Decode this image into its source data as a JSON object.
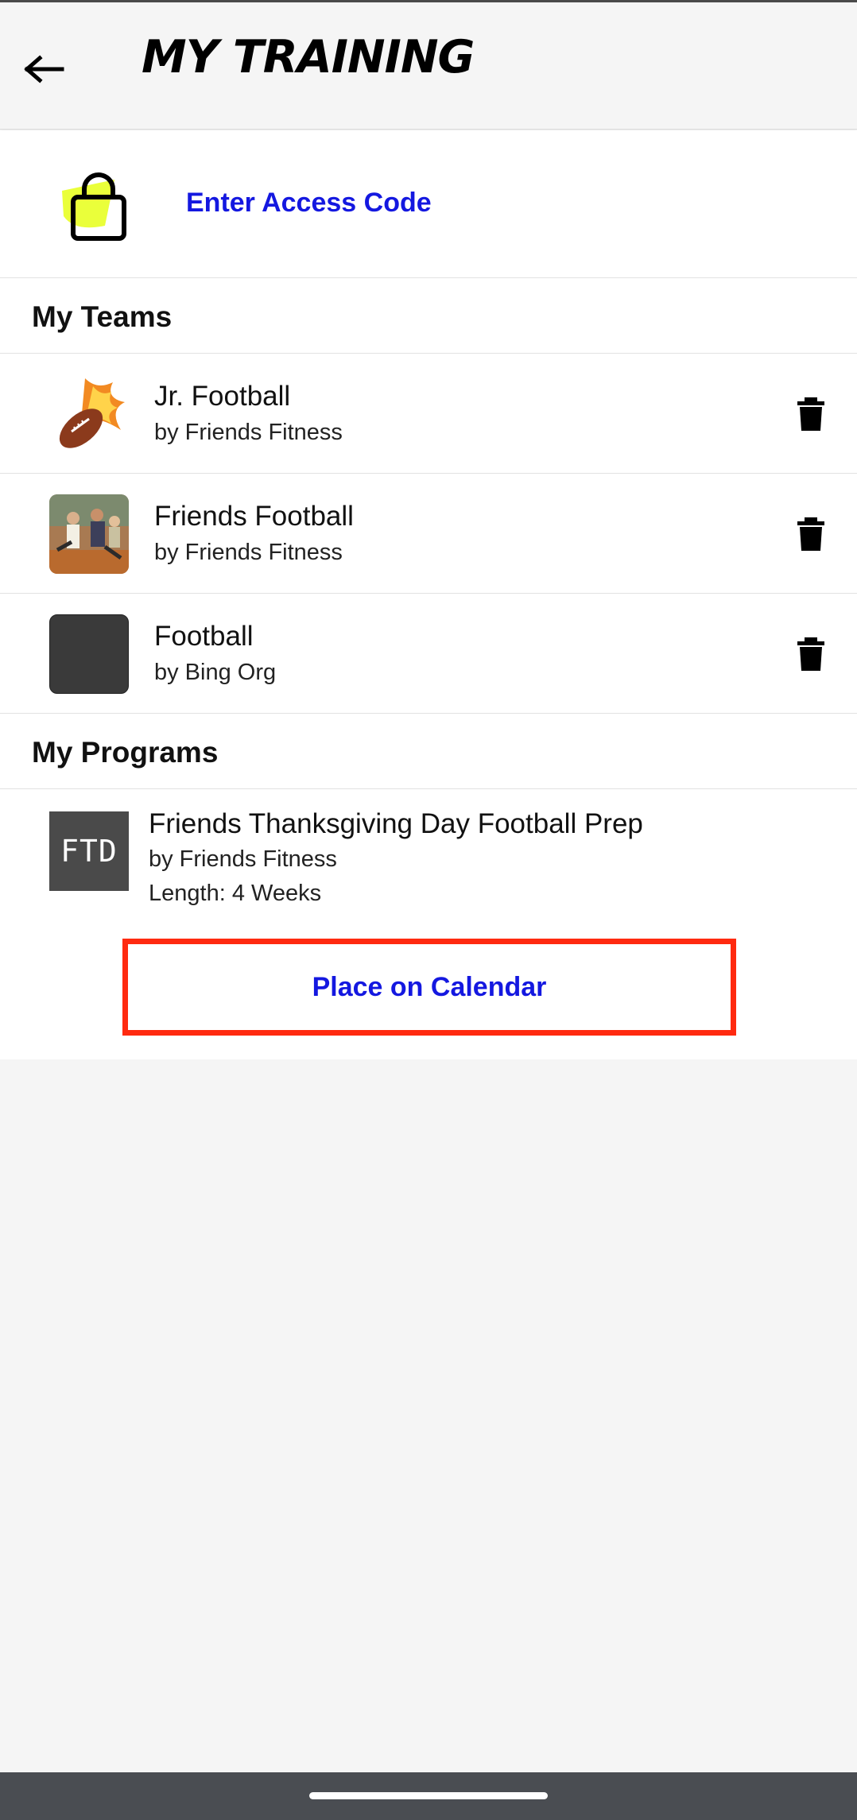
{
  "header": {
    "title": "MY TRAINING",
    "back_icon": "arrow-left-icon"
  },
  "access_code": {
    "label": "Enter Access Code",
    "icon": "lock-icon",
    "icon_highlight_color": "#eaff3a"
  },
  "teams": {
    "section_title": "My Teams",
    "items": [
      {
        "name": "Jr. Football",
        "by": "by Friends Fitness",
        "thumb": "flaming-football-image"
      },
      {
        "name": "Friends Football",
        "by": "by Friends Fitness",
        "thumb": "team-photo-image"
      },
      {
        "name": "Football",
        "by": "by Bing Org",
        "thumb": "placeholder-image"
      }
    ],
    "delete_icon": "trash-icon"
  },
  "programs": {
    "section_title": "My Programs",
    "items": [
      {
        "thumb_text": "FTD",
        "name": "Friends Thanksgiving Day Football Prep",
        "by": "by Friends Fitness",
        "length": "Length: 4 Weeks"
      }
    ]
  },
  "calendar_button": {
    "label": "Place on Calendar",
    "highlight_color": "#ff2a10"
  },
  "colors": {
    "link_blue": "#1418e0",
    "background": "#f5f5f5",
    "navbar": "#4a4d52"
  }
}
